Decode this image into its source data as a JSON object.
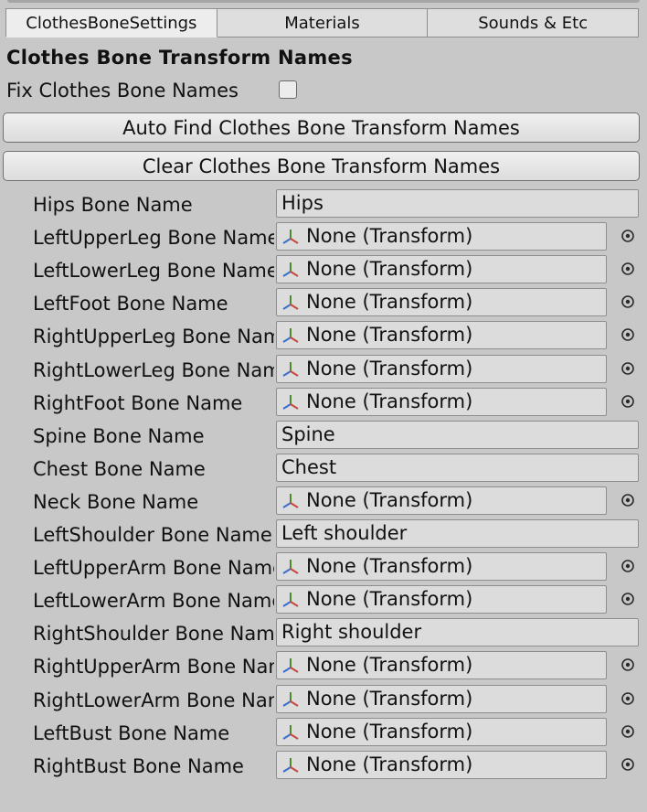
{
  "tabs": [
    "ClothesBoneSettings",
    "Materials",
    "Sounds & Etc"
  ],
  "header": "Clothes Bone Transform Names",
  "fix_label": "Fix Clothes Bone Names",
  "buttons": {
    "auto_find": "Auto Find Clothes Bone Transform Names",
    "clear": "Clear Clothes Bone Transform Names"
  },
  "fields": [
    {
      "label": "Hips Bone Name",
      "type": "text",
      "value": "Hips"
    },
    {
      "label": "LeftUpperLeg Bone Name",
      "type": "object",
      "value": "None (Transform)"
    },
    {
      "label": "LeftLowerLeg Bone Name",
      "type": "object",
      "value": "None (Transform)"
    },
    {
      "label": "LeftFoot Bone Name",
      "type": "object",
      "value": "None (Transform)"
    },
    {
      "label": "RightUpperLeg Bone Name",
      "type": "object",
      "value": "None (Transform)"
    },
    {
      "label": "RightLowerLeg Bone Name",
      "type": "object",
      "value": "None (Transform)"
    },
    {
      "label": "RightFoot Bone Name",
      "type": "object",
      "value": "None (Transform)"
    },
    {
      "label": "Spine Bone Name",
      "type": "text",
      "value": "Spine"
    },
    {
      "label": "Chest Bone Name",
      "type": "text",
      "value": "Chest"
    },
    {
      "label": "Neck Bone Name",
      "type": "object",
      "value": "None (Transform)"
    },
    {
      "label": "LeftShoulder Bone Name",
      "type": "text",
      "value": "Left shoulder"
    },
    {
      "label": "LeftUpperArm Bone Name",
      "type": "object",
      "value": "None (Transform)"
    },
    {
      "label": "LeftLowerArm Bone Name",
      "type": "object",
      "value": "None (Transform)"
    },
    {
      "label": "RightShoulder Bone Name",
      "type": "text",
      "value": "Right shoulder"
    },
    {
      "label": "RightUpperArm Bone Name",
      "type": "object",
      "value": "None (Transform)"
    },
    {
      "label": "RightLowerArm Bone Name",
      "type": "object",
      "value": "None (Transform)"
    },
    {
      "label": "LeftBust Bone Name",
      "type": "object",
      "value": "None (Transform)"
    },
    {
      "label": "RightBust Bone Name",
      "type": "object",
      "value": "None (Transform)"
    }
  ],
  "icons": {
    "transform": "transform-axes-icon",
    "picker": "object-picker-icon"
  }
}
